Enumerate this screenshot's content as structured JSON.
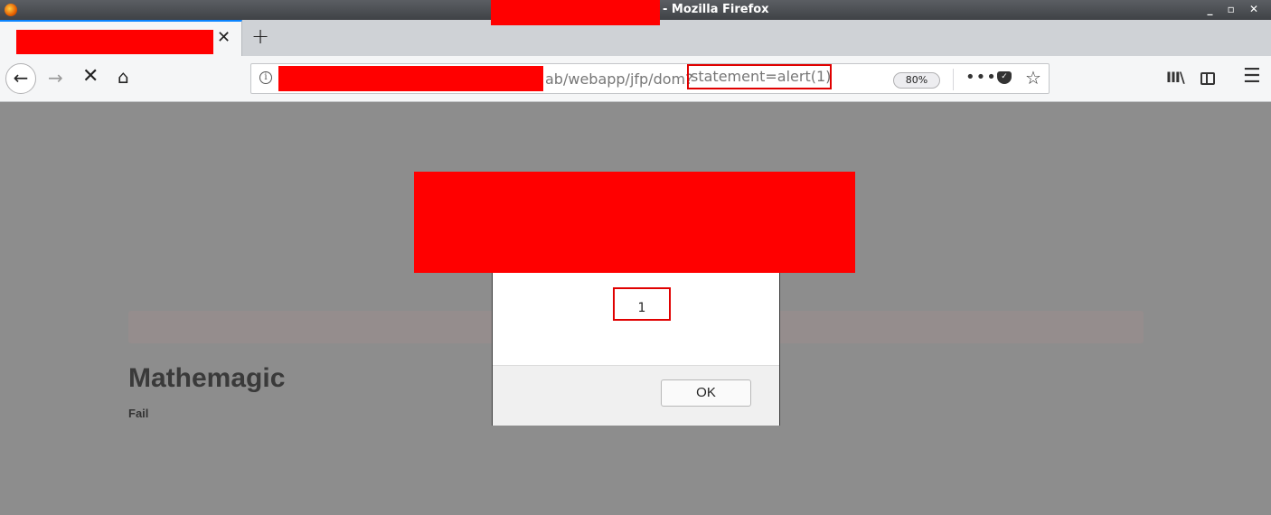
{
  "window": {
    "title_suffix": "- Mozilla Firefox",
    "controls": "_ ▫ ✕"
  },
  "tab": {
    "close_glyph": "✕",
    "new_tab_glyph": "+"
  },
  "navbar": {
    "url_path": "ab/webapp/jfp/dom?",
    "url_query": "statement=alert(1)",
    "zoom": "80%",
    "info_glyph": "i",
    "more_glyph": "•••",
    "star_glyph": "☆",
    "library_glyph": "III\\",
    "menu_glyph": "☰",
    "back_glyph": "←",
    "forward_glyph": "→",
    "stop_glyph": "✕",
    "home_glyph": "⌂"
  },
  "page": {
    "heading": "Mathemagic",
    "result": "Fail"
  },
  "dialog": {
    "message": "1",
    "ok_label": "OK"
  },
  "colors": {
    "redaction": "#ff0000",
    "highlight_border": "#e00000",
    "tab_accent": "#0a84ff"
  }
}
